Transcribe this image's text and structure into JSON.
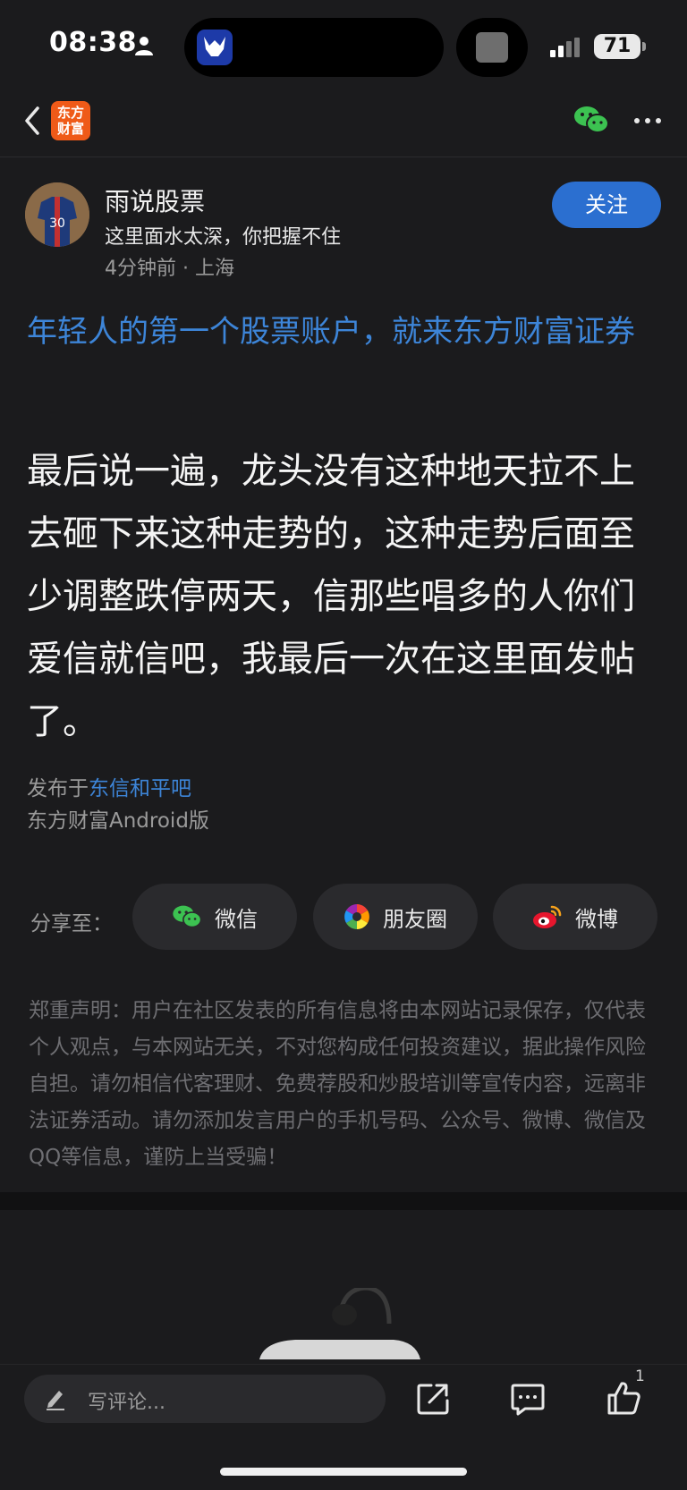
{
  "status_bar": {
    "time": "08:38",
    "battery": "71"
  },
  "nav": {
    "app_logo_line1": "东方",
    "app_logo_line2": "财富"
  },
  "author": {
    "name": "雨说股票",
    "signature": "这里面水太深，你把握不住",
    "meta": "4分钟前 · 上海",
    "follow_label": "关注"
  },
  "promo": {
    "text": "年轻人的第一个股票账户，就来东方财富证券"
  },
  "post": {
    "body": "最后说一遍，龙头没有这种地天拉不上去砸下来这种走势的，这种走势后面至少调整跌停两天，信那些唱多的人你们爱信就信吧，我最后一次在这里面发帖了。",
    "posted_in_prefix": "发布于",
    "board": "东信和平吧",
    "client": "东方财富Android版"
  },
  "share": {
    "label": "分享至：",
    "wechat": "微信",
    "moments": "朋友圈",
    "weibo": "微博"
  },
  "disclaimer": "郑重声明：用户在社区发表的所有信息将由本网站记录保存，仅代表个人观点，与本网站无关，不对您构成任何投资建议，据此操作风险自担。请勿相信代客理财、免费荐股和炒股培训等宣传内容，远离非法证券活动。请勿添加发言用户的手机号码、公众号、微博、微信及QQ等信息，谨防上当受骗！",
  "bottom_bar": {
    "comment_placeholder": "写评论...",
    "like_count": "1"
  },
  "colors": {
    "accent_blue": "#2b6fd0",
    "link_blue": "#3d85d8",
    "brand_orange": "#ef5a18",
    "wechat_green": "#3cc251"
  },
  "icons": [
    "person-icon",
    "back-chevron-icon",
    "wechat-icon",
    "more-dots-icon",
    "moments-icon",
    "weibo-icon",
    "pen-icon",
    "share-out-icon",
    "comment-icon",
    "like-icon"
  ]
}
